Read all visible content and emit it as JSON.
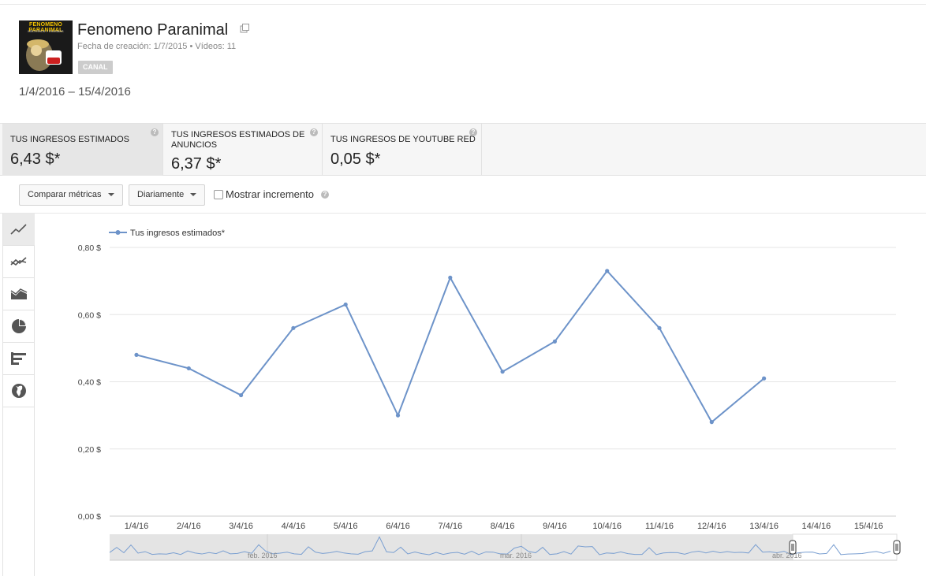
{
  "channel": {
    "name": "Fenomeno Paranimal",
    "meta": "Fecha de creación: 1/7/2015  •  Vídeos: 11",
    "badge": "CANAL",
    "logo_title": "FENOMENO PARANIMAL",
    "logo_sub": "MISTERIOS Y ENIGMAS",
    "logo_youtube": "You Tube"
  },
  "date_range": "1/4/2016 – 15/4/2016",
  "metrics": [
    {
      "label": "TUS INGRESOS ESTIMADOS",
      "value": "6,43 $*"
    },
    {
      "label": "TUS INGRESOS ESTIMADOS DE ANUNCIOS",
      "value": "6,37 $*"
    },
    {
      "label": "TUS INGRESOS DE YOUTUBE RED",
      "value": "0,05 $*"
    }
  ],
  "controls": {
    "compare": "Comparar métricas",
    "interval": "Diariamente",
    "show_increment": "Mostrar incremento",
    "show_increment_checked": false
  },
  "sidebar_icons": [
    "line-chart-icon",
    "multiline-chart-icon",
    "area-chart-icon",
    "pie-chart-icon",
    "bar-chart-icon",
    "globe-icon"
  ],
  "colors": {
    "series": "#6d93c9",
    "grid": "#e6e6e6",
    "axis_text": "#444"
  },
  "chart_data": {
    "type": "line",
    "legend": "Tus ingresos estimados*",
    "categories": [
      "1/4/16",
      "2/4/16",
      "3/4/16",
      "4/4/16",
      "5/4/16",
      "6/4/16",
      "7/4/16",
      "8/4/16",
      "9/4/16",
      "10/4/16",
      "11/4/16",
      "12/4/16",
      "13/4/16",
      "14/4/16",
      "15/4/16"
    ],
    "series": [
      {
        "name": "Tus ingresos estimados*",
        "values": [
          0.48,
          0.44,
          0.36,
          0.56,
          0.63,
          0.3,
          0.71,
          0.43,
          0.52,
          0.73,
          0.56,
          0.28,
          0.41,
          null,
          null
        ]
      }
    ],
    "yticks": [
      "0,00 $",
      "0,20 $",
      "0,40 $",
      "0,60 $",
      "0,80 $"
    ],
    "ylim": [
      0,
      0.8
    ],
    "grid": true,
    "legend_position": "top-left",
    "navigator_labels": [
      "feb. 2016",
      "mar. 2016",
      "abr. 2016"
    ]
  }
}
